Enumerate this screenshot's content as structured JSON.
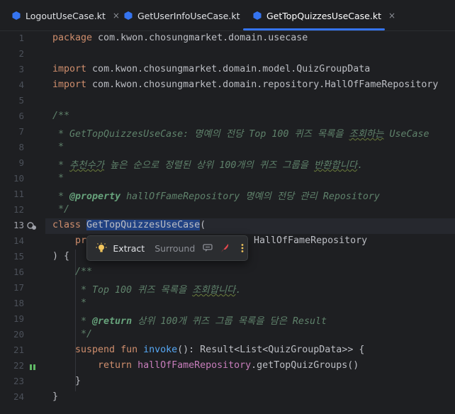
{
  "tabs": [
    {
      "label": "LogoutUseCase.kt",
      "close": "×",
      "active": false
    },
    {
      "label": "GetUserInfoUseCase.kt",
      "close": "",
      "active": false
    },
    {
      "label": "GetTopQuizzesUseCase.kt",
      "close": "×",
      "active": true
    }
  ],
  "gutter": [
    "1",
    "2",
    "3",
    "4",
    "5",
    "6",
    "7",
    "8",
    "9",
    "10",
    "11",
    "12",
    "13",
    "14",
    "15",
    "16",
    "17",
    "18",
    "19",
    "20",
    "21",
    "22",
    "23",
    "24"
  ],
  "code": {
    "l1_kw": "package",
    "l1_rest": " com.kwon.chosungmarket.domain.usecase",
    "l3_kw": "import",
    "l3_rest": " com.kwon.chosungmarket.domain.model.QuizGroupData",
    "l4_kw": "import",
    "l4_rest": " com.kwon.chosungmarket.domain.repository.HallOfFameRepository",
    "l6": "/**",
    "l7_a": " * GetTopQuizzesUseCase: 명예의 전당 Top 100 퀴즈 목록을 ",
    "l7_b": "조회하는",
    "l7_c": " UseCase",
    "l8": " *",
    "l9_a": " * ",
    "l9_b": "추천수가",
    "l9_c": " 높은 순으로 정렬된 상위 100개의 퀴즈 그룹을 ",
    "l9_d": "반환합니다",
    "l9_e": ".",
    "l10": " *",
    "l11_a": " * ",
    "l11_tag": "@property",
    "l11_b": " hallOfFameRepository",
    "l11_c": " 명예의 전당 관리 Repository",
    "l12": " */",
    "l13_kw": "class",
    "l13_sp": " ",
    "l13_sel": "GetTopQuizzesUseCase",
    "l13_rest": "(",
    "l14_kw": "pr",
    "l14_rest": "y: HallOfFameRepository",
    "l15": ") {",
    "l16": "/**",
    "l17_a": " * Top 100 퀴즈 목록을 ",
    "l17_b": "조회합니다",
    "l17_c": ".",
    "l18": " *",
    "l19_a": " * ",
    "l19_tag": "@return",
    "l19_b": " 상위 100개 퀴즈 그룹 목록을 담은 Result",
    "l20": " */",
    "l21_kw1": "suspend",
    "l21_kw2": "fun",
    "l21_fn": "invoke",
    "l21_rest": "(): Result<List<QuizGroupData>> {",
    "l22_kw": "return",
    "l22_prop": "hallOfFameRepository",
    "l22_rest": ".getTopQuizGroups()",
    "l23": "}",
    "l24": "}"
  },
  "popup": {
    "extract": "Extract",
    "surround": "Surround"
  },
  "icons": [
    "kotlin-file-icon",
    "lightbulb-icon",
    "comment-icon",
    "feather-icon",
    "more-vertical-icon",
    "implemented-icon",
    "debug-breakpoint-icon"
  ],
  "colors": {
    "accent": "#3574f0",
    "selection": "#214283"
  }
}
